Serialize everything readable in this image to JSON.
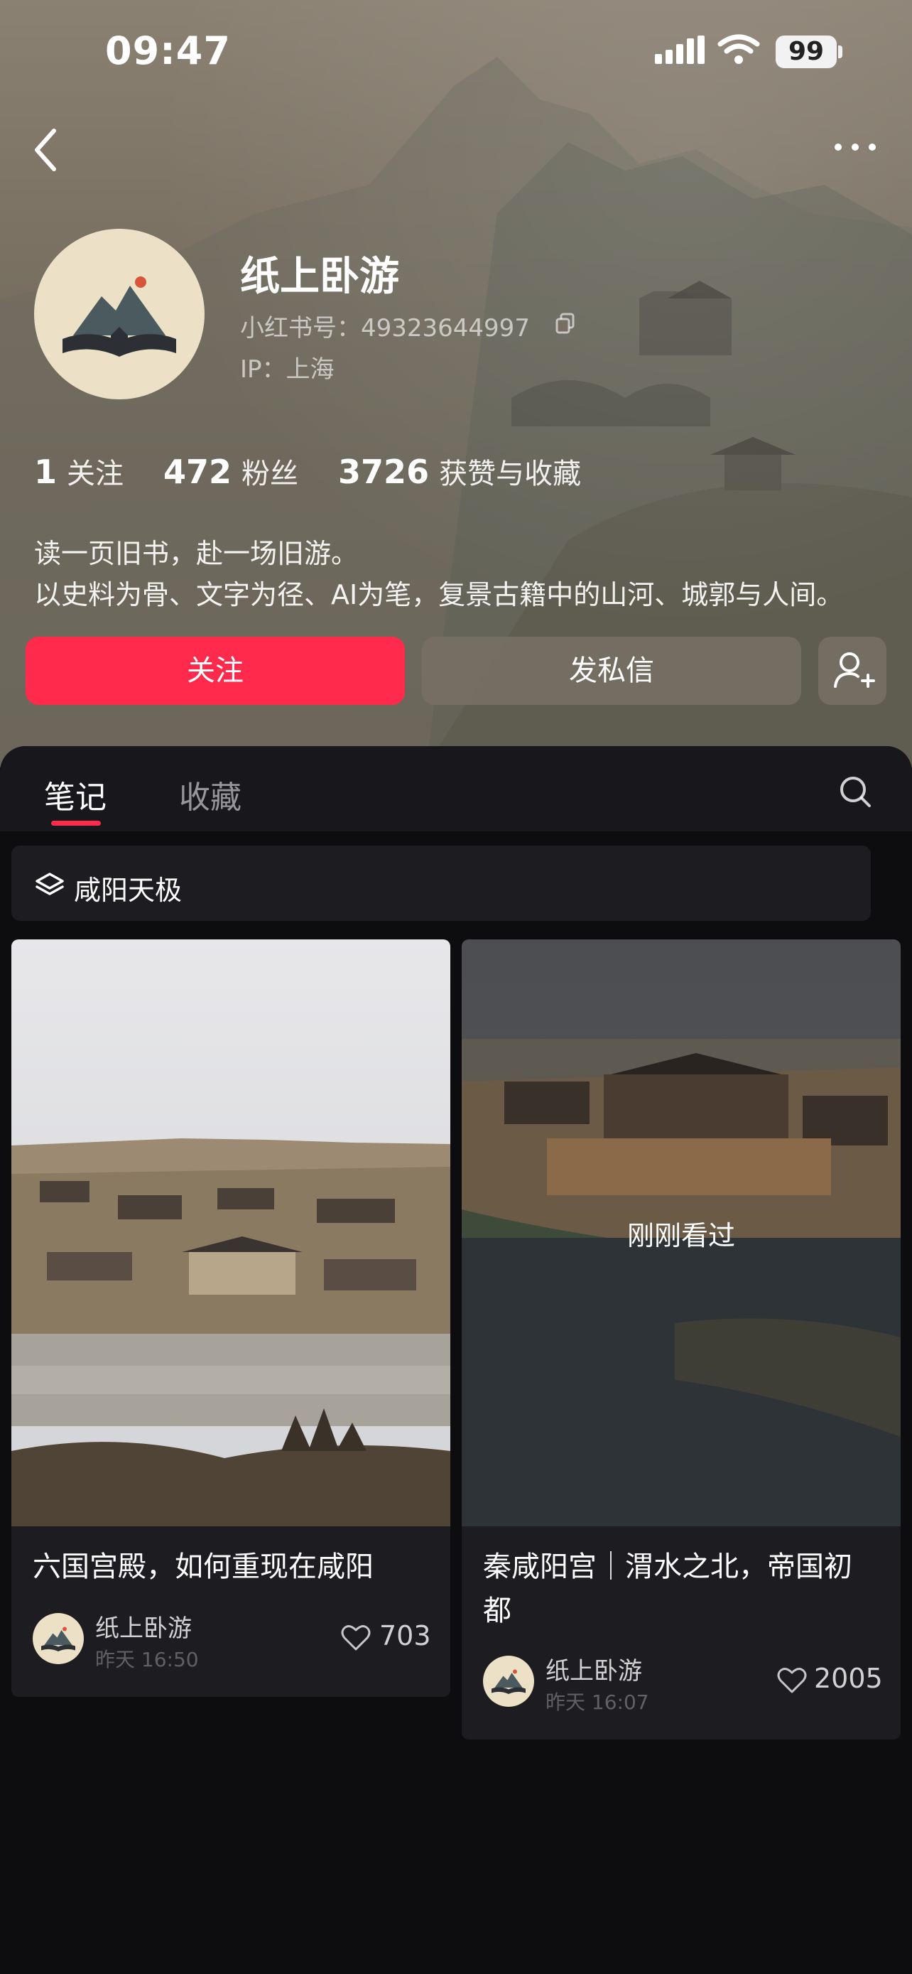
{
  "status_bar": {
    "time": "09:47",
    "battery": "99"
  },
  "profile": {
    "name": "纸上卧游",
    "red_id": "小红书号：49323644997",
    "ip": "IP：上海",
    "stats": [
      {
        "num": "1",
        "label": "关注"
      },
      {
        "num": "472",
        "label": "粉丝"
      },
      {
        "num": "3726",
        "label": "获赞与收藏"
      }
    ],
    "bio": [
      "读一页旧书，赴一场旧游。",
      "以史料为骨、文字为径、AI为笔，复景古籍中的山河、城郭与人间。"
    ]
  },
  "actions": {
    "follow": "关注",
    "message": "发私信"
  },
  "tabs": {
    "notes": "笔记",
    "collect": "收藏"
  },
  "collection": {
    "label": "咸阳天极"
  },
  "cards": [
    {
      "title": "六国宫殿，如何重现在咸阳",
      "author": "纸上卧游",
      "date": "昨天 16:50",
      "likes": "703"
    },
    {
      "title_line1": "秦咸阳宫｜渭水之北，帝国初",
      "title_line2": "都",
      "author": "纸上卧游",
      "date": "昨天 16:07",
      "likes": "2005",
      "overlay": "刚刚看过"
    }
  ],
  "colors": {
    "accent": "#ff2a4c",
    "panel": "#1c1c21",
    "background": "#0d0d10"
  },
  "icons": [
    "back-arrow",
    "more-dots",
    "copy",
    "add-user",
    "search",
    "layers",
    "heart"
  ]
}
